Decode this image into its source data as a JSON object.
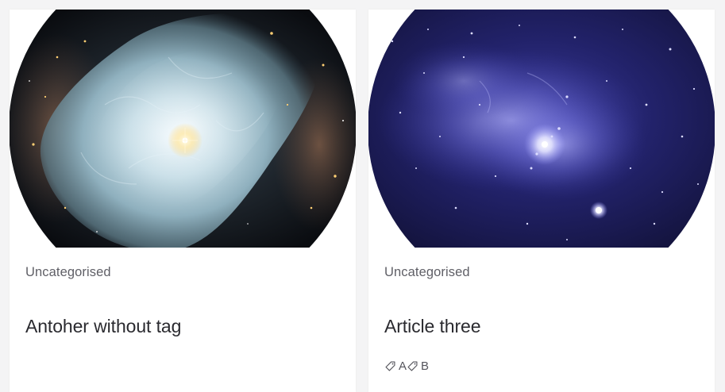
{
  "cards": [
    {
      "category": "Uncategorised",
      "title": "Antoher without tag",
      "image_icon": "nebula-image",
      "tags": []
    },
    {
      "category": "Uncategorised",
      "title": "Article three",
      "image_icon": "galaxy-center-image",
      "tags": [
        {
          "label": "A",
          "icon": "tag-icon"
        },
        {
          "label": "B",
          "icon": "tag-icon"
        }
      ]
    }
  ],
  "colors": {
    "page_background": "#f4f4f5",
    "card_background": "#ffffff",
    "text_muted": "#5f5f66",
    "text_heading": "#2a2a2f",
    "nebula_core": "#dbe9f2",
    "galaxy_field": "#20205e"
  }
}
